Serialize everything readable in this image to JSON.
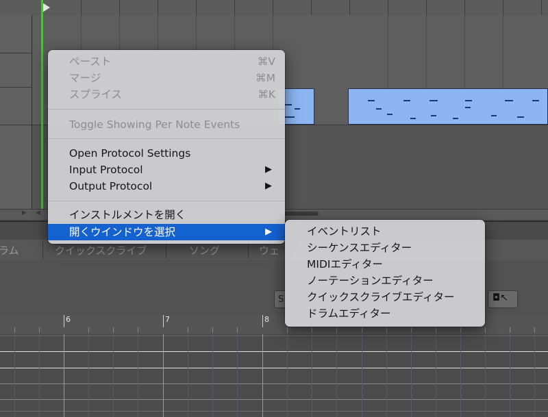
{
  "context_menu": {
    "items": [
      {
        "label": "ペースト",
        "shortcut": "⌘V",
        "enabled": false
      },
      {
        "label": "マージ",
        "shortcut": "⌘M",
        "enabled": false
      },
      {
        "label": "スプライス",
        "shortcut": "⌘K",
        "enabled": false
      },
      {
        "label": "Toggle Showing Per Note Events",
        "enabled": false
      },
      {
        "label": "Open Protocol Settings",
        "enabled": true
      },
      {
        "label": "Input Protocol",
        "enabled": true,
        "submenu_arrow": "▶"
      },
      {
        "label": "Output Protocol",
        "enabled": true,
        "submenu_arrow": "▶"
      },
      {
        "label": "インストルメントを開く",
        "enabled": true
      },
      {
        "label": "開くウインドウを選択",
        "enabled": true,
        "selected": true,
        "submenu_arrow": "▶"
      }
    ]
  },
  "submenu": {
    "items": [
      "イベントリスト",
      "シーケンスエディター",
      "MIDIエディター",
      "ノーテーションエディター",
      "クイックスクライブエディター",
      "ドラムエディター"
    ]
  },
  "tabs": [
    "ラム",
    "クイックスクライブ",
    "ソング",
    "ウェ"
  ],
  "editor": {
    "field_text": "S",
    "ruler_numbers": [
      "6",
      "7",
      "8"
    ]
  },
  "colors": {
    "selection": "#1462d0",
    "region": "#8db5f2",
    "playhead": "#58b84a"
  }
}
